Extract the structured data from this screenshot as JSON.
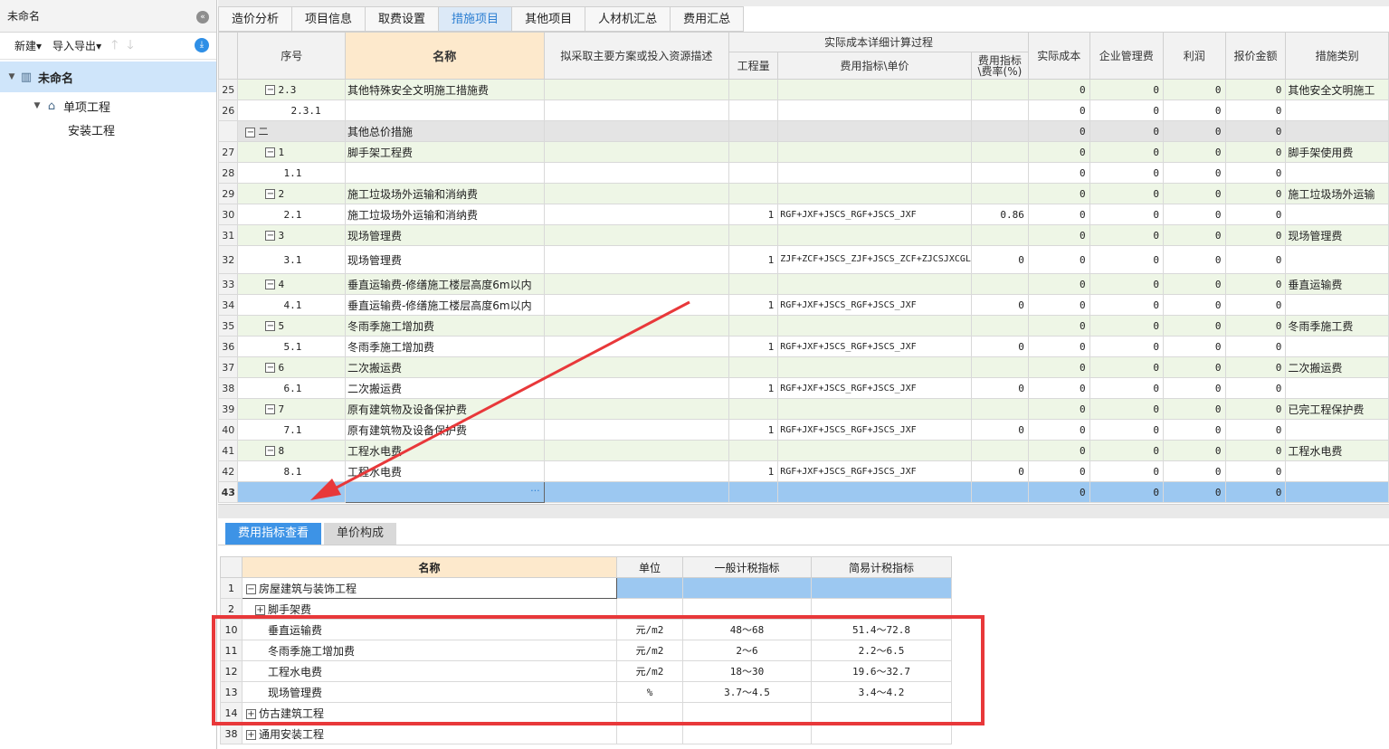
{
  "left_panel": {
    "title": "未命名",
    "new_label": "新建",
    "import_export_label": "导入导出",
    "tree": [
      {
        "label": "未命名",
        "level": 0
      },
      {
        "label": "单项工程",
        "level": 1
      },
      {
        "label": "安装工程",
        "level": 2
      }
    ]
  },
  "tabs": [
    "造价分析",
    "项目信息",
    "取费设置",
    "措施项目",
    "其他项目",
    "人材机汇总",
    "费用汇总"
  ],
  "active_tab": "措施项目",
  "grid": {
    "headers": {
      "seq": "序号",
      "name": "名称",
      "desc": "拟采取主要方案或投入资源描述",
      "group": "实际成本详细计算过程",
      "qty": "工程量",
      "formula": "费用指标\\单价",
      "rate": "费用指标\\费率(%)",
      "cost": "实际成本",
      "mgmt": "企业管理费",
      "profit": "利润",
      "quote": "报价金额",
      "category": "措施类别"
    },
    "rows": [
      {
        "rn": "25",
        "seq": "2.3",
        "name": "其他特殊安全文明施工措施费",
        "qty": "",
        "formula": "",
        "rate": "",
        "cost": "0",
        "mgmt": "0",
        "profit": "0",
        "quote": "0",
        "category": "其他安全文明施工"
      },
      {
        "rn": "26",
        "seq": "2.3.1",
        "name": "",
        "qty": "",
        "formula": "",
        "rate": "",
        "cost": "0",
        "mgmt": "0",
        "profit": "0",
        "quote": "0",
        "category": ""
      },
      {
        "rn": "",
        "seq": "二",
        "name": "其他总价措施",
        "qty": "",
        "formula": "",
        "rate": "",
        "cost": "0",
        "mgmt": "0",
        "profit": "0",
        "quote": "0",
        "category": ""
      },
      {
        "rn": "27",
        "seq": "1",
        "name": "脚手架工程费",
        "qty": "",
        "formula": "",
        "rate": "",
        "cost": "0",
        "mgmt": "0",
        "profit": "0",
        "quote": "0",
        "category": "脚手架使用费"
      },
      {
        "rn": "28",
        "seq": "1.1",
        "name": "",
        "qty": "",
        "formula": "",
        "rate": "",
        "cost": "0",
        "mgmt": "0",
        "profit": "0",
        "quote": "0",
        "category": ""
      },
      {
        "rn": "29",
        "seq": "2",
        "name": "施工垃圾场外运输和消纳费",
        "qty": "",
        "formula": "",
        "rate": "",
        "cost": "0",
        "mgmt": "0",
        "profit": "0",
        "quote": "0",
        "category": "施工垃圾场外运输"
      },
      {
        "rn": "30",
        "seq": "2.1",
        "name": "施工垃圾场外运输和消纳费",
        "qty": "1",
        "formula": "RGF+JXF+JSCS_RGF+JSCS_JXF",
        "rate": "0.86",
        "cost": "0",
        "mgmt": "0",
        "profit": "0",
        "quote": "0",
        "category": ""
      },
      {
        "rn": "31",
        "seq": "3",
        "name": "现场管理费",
        "qty": "",
        "formula": "",
        "rate": "",
        "cost": "0",
        "mgmt": "0",
        "profit": "0",
        "quote": "0",
        "category": "现场管理费"
      },
      {
        "rn": "32",
        "seq": "3.1",
        "name": "现场管理费",
        "qty": "1",
        "formula": "ZJF+ZCF+JSCS_ZJF+JSCS_ZCF+ZJCSJXCGL",
        "rate": "0",
        "cost": "0",
        "mgmt": "0",
        "profit": "0",
        "quote": "0",
        "category": ""
      },
      {
        "rn": "33",
        "seq": "4",
        "name": "垂直运输费-修缮施工楼层高度6m以内",
        "qty": "",
        "formula": "",
        "rate": "",
        "cost": "0",
        "mgmt": "0",
        "profit": "0",
        "quote": "0",
        "category": "垂直运输费"
      },
      {
        "rn": "34",
        "seq": "4.1",
        "name": "垂直运输费-修缮施工楼层高度6m以内",
        "qty": "1",
        "formula": "RGF+JXF+JSCS_RGF+JSCS_JXF",
        "rate": "0",
        "cost": "0",
        "mgmt": "0",
        "profit": "0",
        "quote": "0",
        "category": ""
      },
      {
        "rn": "35",
        "seq": "5",
        "name": "冬雨季施工增加费",
        "qty": "",
        "formula": "",
        "rate": "",
        "cost": "0",
        "mgmt": "0",
        "profit": "0",
        "quote": "0",
        "category": "冬雨季施工费"
      },
      {
        "rn": "36",
        "seq": "5.1",
        "name": "冬雨季施工增加费",
        "qty": "1",
        "formula": "RGF+JXF+JSCS_RGF+JSCS_JXF",
        "rate": "0",
        "cost": "0",
        "mgmt": "0",
        "profit": "0",
        "quote": "0",
        "category": ""
      },
      {
        "rn": "37",
        "seq": "6",
        "name": "二次搬运费",
        "qty": "",
        "formula": "",
        "rate": "",
        "cost": "0",
        "mgmt": "0",
        "profit": "0",
        "quote": "0",
        "category": "二次搬运费"
      },
      {
        "rn": "38",
        "seq": "6.1",
        "name": "二次搬运费",
        "qty": "1",
        "formula": "RGF+JXF+JSCS_RGF+JSCS_JXF",
        "rate": "0",
        "cost": "0",
        "mgmt": "0",
        "profit": "0",
        "quote": "0",
        "category": ""
      },
      {
        "rn": "39",
        "seq": "7",
        "name": "原有建筑物及设备保护费",
        "qty": "",
        "formula": "",
        "rate": "",
        "cost": "0",
        "mgmt": "0",
        "profit": "0",
        "quote": "0",
        "category": "已完工程保护费"
      },
      {
        "rn": "40",
        "seq": "7.1",
        "name": "原有建筑物及设备保护费",
        "qty": "1",
        "formula": "RGF+JXF+JSCS_RGF+JSCS_JXF",
        "rate": "0",
        "cost": "0",
        "mgmt": "0",
        "profit": "0",
        "quote": "0",
        "category": ""
      },
      {
        "rn": "41",
        "seq": "8",
        "name": "工程水电费",
        "qty": "",
        "formula": "",
        "rate": "",
        "cost": "0",
        "mgmt": "0",
        "profit": "0",
        "quote": "0",
        "category": "工程水电费"
      },
      {
        "rn": "42",
        "seq": "8.1",
        "name": "工程水电费",
        "qty": "1",
        "formula": "RGF+JXF+JSCS_RGF+JSCS_JXF",
        "rate": "0",
        "cost": "0",
        "mgmt": "0",
        "profit": "0",
        "quote": "0",
        "category": ""
      },
      {
        "rn": "43",
        "seq": "",
        "name": "",
        "qty": "",
        "formula": "",
        "rate": "",
        "cost": "0",
        "mgmt": "0",
        "profit": "0",
        "quote": "0",
        "category": ""
      }
    ]
  },
  "bottom": {
    "tabs": [
      "费用指标查看",
      "单价构成"
    ],
    "active_tab": "费用指标查看",
    "headers": {
      "name": "名称",
      "unit": "单位",
      "general": "一般计税指标",
      "simple": "简易计税指标"
    },
    "rows": [
      {
        "rn": "1",
        "name": "房屋建筑与装饰工程",
        "unit": "",
        "general": "",
        "simple": ""
      },
      {
        "rn": "2",
        "name": "脚手架费",
        "unit": "",
        "general": "",
        "simple": ""
      },
      {
        "rn": "10",
        "name": "垂直运输费",
        "unit": "元/m2",
        "general": "48～68",
        "simple": "51.4～72.8"
      },
      {
        "rn": "11",
        "name": "冬雨季施工增加费",
        "unit": "元/m2",
        "general": "2～6",
        "simple": "2.2～6.5"
      },
      {
        "rn": "12",
        "name": "工程水电费",
        "unit": "元/m2",
        "general": "18～30",
        "simple": "19.6～32.7"
      },
      {
        "rn": "13",
        "name": "现场管理费",
        "unit": "%",
        "general": "3.7～4.5",
        "simple": "3.4～4.2"
      },
      {
        "rn": "14",
        "name": "仿古建筑工程",
        "unit": "",
        "general": "",
        "simple": ""
      },
      {
        "rn": "38",
        "name": "通用安装工程",
        "unit": "",
        "general": "",
        "simple": ""
      }
    ]
  },
  "colors": {
    "accent": "#2d7fd2",
    "selection": "#9cc8f1",
    "annotation": "#e8383a",
    "header_name": "#fde9cc"
  }
}
